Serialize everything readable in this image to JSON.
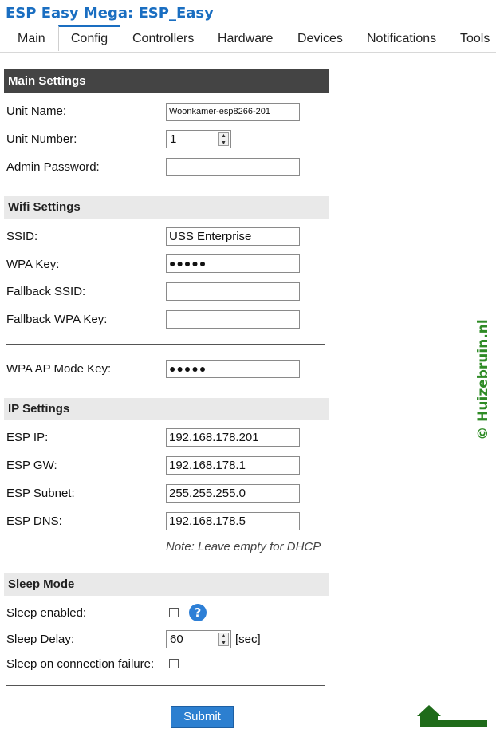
{
  "app": {
    "title": "ESP Easy Mega: ESP_Easy"
  },
  "tabs": [
    "Main",
    "Config",
    "Controllers",
    "Hardware",
    "Devices",
    "Notifications",
    "Tools"
  ],
  "active_tab": "Config",
  "main_settings": {
    "header": "Main Settings",
    "unit_name_label": "Unit Name:",
    "unit_name_value": "Woonkamer-esp8266-201",
    "unit_number_label": "Unit Number:",
    "unit_number_value": "1",
    "admin_password_label": "Admin Password:",
    "admin_password_value": ""
  },
  "wifi_settings": {
    "header": "Wifi Settings",
    "ssid_label": "SSID:",
    "ssid_value": "USS Enterprise",
    "wpa_key_label": "WPA Key:",
    "wpa_key_value": "●●●●●",
    "fallback_ssid_label": "Fallback SSID:",
    "fallback_ssid_value": "",
    "fallback_wpa_key_label": "Fallback WPA Key:",
    "fallback_wpa_key_value": "",
    "ap_mode_key_label": "WPA AP Mode Key:",
    "ap_mode_key_value": "●●●●●"
  },
  "ip_settings": {
    "header": "IP Settings",
    "esp_ip_label": "ESP IP:",
    "esp_ip_value": "192.168.178.201",
    "esp_gw_label": "ESP GW:",
    "esp_gw_value": "192.168.178.1",
    "esp_subnet_label": "ESP Subnet:",
    "esp_subnet_value": "255.255.255.0",
    "esp_dns_label": "ESP DNS:",
    "esp_dns_value": "192.168.178.5",
    "note": "Note: Leave empty for DHCP"
  },
  "sleep_mode": {
    "header": "Sleep Mode",
    "sleep_enabled_label": "Sleep enabled:",
    "sleep_enabled_checked": false,
    "help_icon": "?",
    "sleep_delay_label": "Sleep Delay:",
    "sleep_delay_value": "60",
    "sleep_delay_unit": "[sec]",
    "sleep_on_failure_label": "Sleep on connection failure:",
    "sleep_on_failure_checked": false
  },
  "submit_label": "Submit",
  "watermark": "© Huizebruin.nl",
  "colors": {
    "accent": "#1a6ec1",
    "header_dark": "#444444",
    "header_light": "#e9e9e9",
    "button": "#2c7fd0",
    "watermark": "#2e8b25"
  }
}
